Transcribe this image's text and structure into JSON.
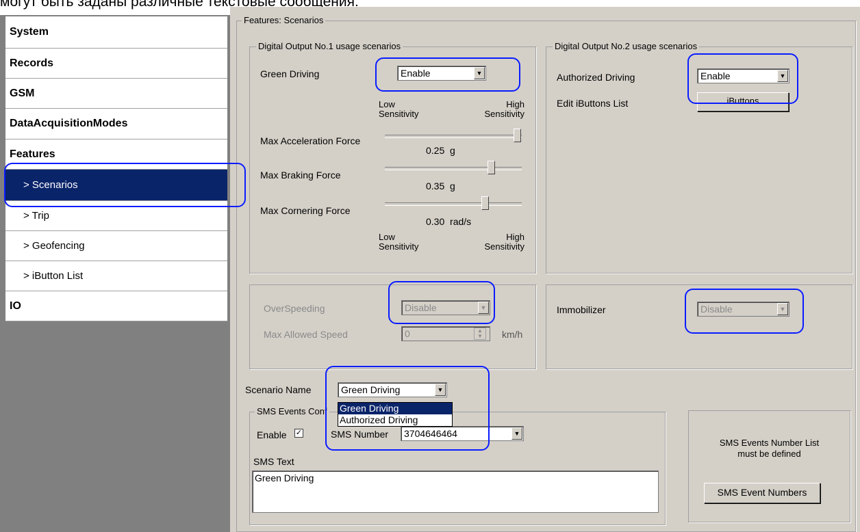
{
  "caption": "могут быть заданы различные текстовые сообщения:",
  "sidebar": {
    "items": [
      {
        "label": "System"
      },
      {
        "label": "Records"
      },
      {
        "label": "GSM"
      },
      {
        "label": "DataAcquisitionModes"
      },
      {
        "label": "Features"
      },
      {
        "label": "> Scenarios",
        "selected": true
      },
      {
        "label": "> Trip"
      },
      {
        "label": "> Geofencing"
      },
      {
        "label": "> iButton List"
      },
      {
        "label": "IO"
      }
    ]
  },
  "main": {
    "title": "Features: Scenarios",
    "do1": {
      "legend": "Digital Output No.1 usage scenarios",
      "green_driving_label": "Green Driving",
      "green_driving_value": "Enable",
      "low_label": "Low",
      "high_label": "High",
      "sensitivity_label": "Sensitivity",
      "max_accel_label": "Max Acceleration Force",
      "max_accel_value": "0.25",
      "max_accel_unit": "g",
      "max_accel_level": 1.0,
      "max_brake_label": "Max Braking Force",
      "max_brake_value": "0.35",
      "max_brake_unit": "g",
      "max_brake_level": 0.8,
      "max_corner_label": "Max Cornering Force",
      "max_corner_value": "0.30",
      "max_corner_unit": "rad/s",
      "max_corner_level": 0.75
    },
    "do2": {
      "legend": "Digital Output No.2 usage scenarios",
      "authorized_label": "Authorized Driving",
      "authorized_value": "Enable",
      "edit_ibuttons_label": "Edit iButtons List",
      "ibuttons_button": "iButtons"
    },
    "overspeed": {
      "label": "OverSpeeding",
      "value": "Disable",
      "max_speed_label": "Max Allowed Speed",
      "max_speed_value": "0",
      "unit": "km/h"
    },
    "immobilizer": {
      "label": "Immobilizer",
      "value": "Disable"
    },
    "scenario": {
      "label": "Scenario Name",
      "value": "Green Driving",
      "options": [
        "Green Driving",
        "Authorized Driving"
      ]
    },
    "sms": {
      "legend": "SMS Events Conf",
      "enable_label": "Enable",
      "enable_checked": "✓",
      "number_label": "SMS Number",
      "number_value": "3704646464",
      "text_label": "SMS Text",
      "text_value": "Green Driving"
    },
    "sms_list": {
      "line1": "SMS Events Number List",
      "line2": "must be defined",
      "button": "SMS Event Numbers"
    }
  },
  "colors": {
    "panel": "#d4d0c8",
    "selection": "#0a246a",
    "highlight": "#0a1cff",
    "sidebar_bg": "#808080"
  }
}
